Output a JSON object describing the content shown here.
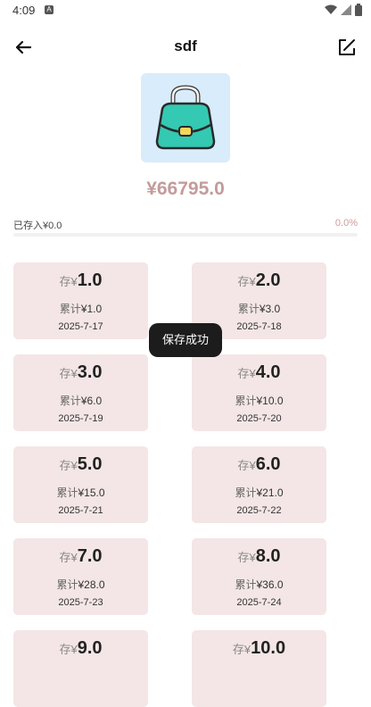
{
  "status_bar": {
    "time": "4:09",
    "notification_icon": "a-icon",
    "wifi_icon": "wifi-icon",
    "signal_icon": "signal-icon",
    "battery_icon": "battery-icon"
  },
  "header": {
    "title": "sdf",
    "back_icon": "arrow-left-icon",
    "edit_icon": "edit-icon"
  },
  "goal": {
    "image_icon": "handbag-icon",
    "amount": "¥66795.0",
    "saved_label": "已存入¥0.0",
    "percent_label": "0.0%",
    "progress": 0.0,
    "accent_color": "#c39b9b"
  },
  "toast": {
    "text": "保存成功"
  },
  "cards": [
    {
      "prefix": "存¥",
      "amount": "1.0",
      "total_prefix": "累计",
      "total": "¥1.0",
      "date": "2025-7-17"
    },
    {
      "prefix": "存¥",
      "amount": "2.0",
      "total_prefix": "累计",
      "total": "¥3.0",
      "date": "2025-7-18"
    },
    {
      "prefix": "存¥",
      "amount": "3.0",
      "total_prefix": "累计",
      "total": "¥6.0",
      "date": "2025-7-19"
    },
    {
      "prefix": "存¥",
      "amount": "4.0",
      "total_prefix": "累计",
      "total": "¥10.0",
      "date": "2025-7-20"
    },
    {
      "prefix": "存¥",
      "amount": "5.0",
      "total_prefix": "累计",
      "total": "¥15.0",
      "date": "2025-7-21"
    },
    {
      "prefix": "存¥",
      "amount": "6.0",
      "total_prefix": "累计",
      "total": "¥21.0",
      "date": "2025-7-22"
    },
    {
      "prefix": "存¥",
      "amount": "7.0",
      "total_prefix": "累计",
      "total": "¥28.0",
      "date": "2025-7-23"
    },
    {
      "prefix": "存¥",
      "amount": "8.0",
      "total_prefix": "累计",
      "total": "¥36.0",
      "date": "2025-7-24"
    },
    {
      "prefix": "存¥",
      "amount": "9.0"
    },
    {
      "prefix": "存¥",
      "amount": "10.0"
    }
  ]
}
